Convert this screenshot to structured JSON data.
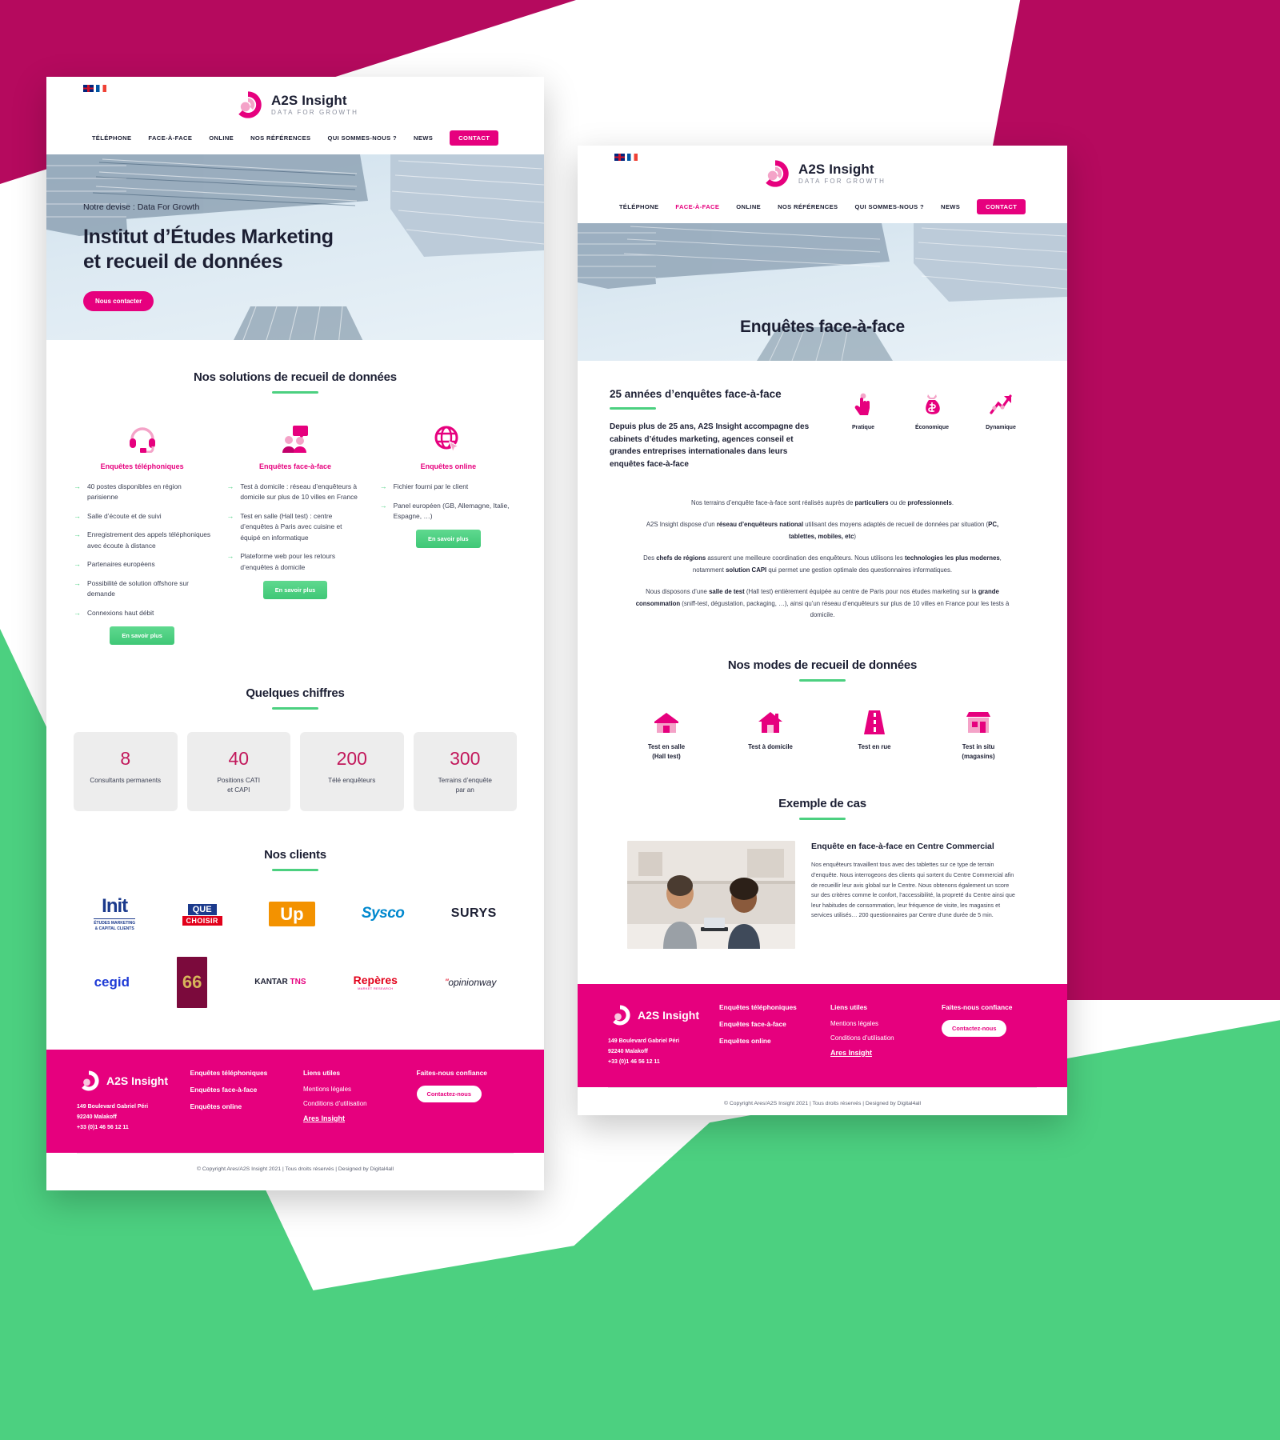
{
  "palette": {
    "magenta": "#b50a5e",
    "pink": "#e6007e",
    "green": "#4cd080",
    "ink": "#1c1f33",
    "grey_card": "#ededed",
    "stat_number": "#c2185b"
  },
  "brand": {
    "name": "A2S Insight",
    "tagline": "DATA FOR GROWTH",
    "logo_icon": "spiral-swirl-logo"
  },
  "languages": [
    {
      "name": "english-flag",
      "code": "EN"
    },
    {
      "name": "french-flag",
      "code": "FR"
    }
  ],
  "nav": {
    "items": [
      "TÉLÉPHONE",
      "FACE-À-FACE",
      "ONLINE",
      "NOS RÉFÉRENCES",
      "QUI SOMMES-NOUS ?",
      "NEWS"
    ],
    "cta": "CONTACT",
    "active_on_page2": "FACE-À-FACE"
  },
  "home": {
    "hero": {
      "kicker": "Notre devise : Data For Growth",
      "title": "Institut d’Études Marketing\net recueil de données",
      "button": "Nous contacter"
    },
    "solutions": {
      "title": "Nos solutions de recueil de données",
      "columns": [
        {
          "icon": "headset-icon",
          "heading": "Enquêtes téléphoniques",
          "bullets": [
            "40 postes disponibles en région parisienne",
            "Salle d’écoute et de suivi",
            "Enregistrement des appels téléphoniques avec écoute à distance",
            "Partenaires européens",
            "Possibilité de solution offshore sur demande",
            "Connexions haut débit"
          ],
          "button": "En savoir plus"
        },
        {
          "icon": "two-people-speech-icon",
          "heading": "Enquêtes face-à-face",
          "bullets": [
            "Test à domicile : réseau d’enquêteurs à domicile sur plus de 10 villes en France",
            "Test en salle (Hall test) : centre d’enquêtes à Paris avec cuisine et équipé en informatique",
            "Plateforme web pour les retours d’enquêtes à domicile"
          ],
          "button": "En savoir plus"
        },
        {
          "icon": "globe-cursor-icon",
          "heading": "Enquêtes online",
          "bullets": [
            "Fichier fourni par le client",
            "Panel européen (GB, Allemagne, Italie, Espagne, …)"
          ],
          "button": "En savoir plus"
        }
      ]
    },
    "figures": {
      "title": "Quelques chiffres",
      "stats": [
        {
          "number": "8",
          "label": "Consultants permanents"
        },
        {
          "number": "40",
          "label": "Positions CATI\net CAPI"
        },
        {
          "number": "200",
          "label": "Télé enquêteurs"
        },
        {
          "number": "300",
          "label": "Terrains d’enquête\npar an"
        }
      ]
    },
    "clients": {
      "title": "Nos clients",
      "row1": [
        {
          "name": "init",
          "label": "Init",
          "sub": "ÉTUDES MARKETING\n& CAPITAL CLIENTS",
          "color": "#1b3a8c"
        },
        {
          "name": "que-choisir",
          "label": "QUE CHOISIR",
          "color": "#e2001a"
        },
        {
          "name": "up",
          "label": "Up",
          "color": "#f39200"
        },
        {
          "name": "sysco",
          "label": "Sysco",
          "color": "#0088ce"
        },
        {
          "name": "surys",
          "label": "SURYS",
          "color": "#1c1f33"
        }
      ],
      "row2": [
        {
          "name": "cegid",
          "label": "cegid",
          "color": "#1f3bd6"
        },
        {
          "name": "route66",
          "label": "ROUTE 66",
          "color": "#7b0a3c"
        },
        {
          "name": "kantar-tns",
          "label": "KANTAR TNS",
          "color": "#1c1f33"
        },
        {
          "name": "reperes",
          "label": "Repères",
          "color": "#e2001a"
        },
        {
          "name": "opinionway",
          "label": "opinionway",
          "color": "#1c1f33"
        }
      ]
    }
  },
  "f2f": {
    "hero_title": "Enquêtes face-à-face",
    "intro": {
      "heading": "25 années d’enquêtes face-à-face",
      "paragraph": "Depuis plus de 25 ans, A2S Insight accompagne des cabinets d’études marketing, agences conseil et grandes entreprises internationales dans leurs enquêtes face-à-face"
    },
    "advantages": [
      {
        "icon": "hand-tap-icon",
        "label": "Pratique"
      },
      {
        "icon": "money-bag-icon",
        "label": "Économique"
      },
      {
        "icon": "arrow-chart-icon",
        "label": "Dynamique"
      }
    ],
    "paragraphs": [
      "Nos terrains d’enquête face-à-face sont réalisés auprès de <b>particuliers</b> ou de <b>professionnels</b>.",
      "A2S Insight dispose d’un <b>réseau d’enquêteurs national</b> utilisant des moyens adaptés de recueil de données par situation (<b>PC, tablettes, mobiles, etc</b>)",
      "Des <b>chefs de régions</b> assurent une meilleure coordination des enquêteurs. Nous utilisons les <b>technologies les plus modernes</b>, notamment <b>solution CAPI</b> qui permet une gestion optimale des questionnaires informatiques.",
      "Nous disposons d’une <b>salle de test</b> (Hall test) entièrement équipée au centre de Paris pour nos études marketing sur la <b>grande consommation</b> (sniff-test, dégustation, packaging, …), ainsi qu’un réseau d’enquêteurs sur plus de 10 villes en France pour les tests à domicile."
    ],
    "modes": {
      "title": "Nos modes de recueil de données",
      "items": [
        {
          "icon": "hall-test-icon",
          "label": "Test en salle\n(Hall test)"
        },
        {
          "icon": "house-icon",
          "label": "Test à domicile"
        },
        {
          "icon": "street-icon",
          "label": "Test en rue"
        },
        {
          "icon": "shop-icon",
          "label": "Test in situ\n(magasins)"
        }
      ]
    },
    "case": {
      "title": "Exemple de cas",
      "heading": "Enquête en face-à-face en Centre Commercial",
      "image": "interviewer-with-tablet-photo",
      "text": "Nos enquêteurs travaillent tous avec des tablettes sur ce type de terrain d’enquête. Nous interrogeons des clients qui sortent du Centre Commercial afin de recueillir leur avis global sur le Centre. Nous obtenons également un score sur des critères comme le confort, l’accessibilité, la propreté du Centre ainsi que leur habitudes de consommation, leur fréquence de visite, les magasins et services utilisés… 200 questionnaires par Centre d’une durée de 5 min."
    }
  },
  "footer": {
    "brand_name": "A2S Insight",
    "address_lines": [
      "149 Boulevard Gabriel Péri",
      "92240 Malakoff",
      "+33 (0)1 46 56 12 11"
    ],
    "services": [
      "Enquêtes téléphoniques",
      "Enquêtes face-à-face",
      "Enquêtes online"
    ],
    "useful_title": "Liens utiles",
    "useful": [
      "Mentions légales",
      "Conditions d’utilisation"
    ],
    "ares_link": "Ares Insight",
    "trust_title": "Faites-nous confiance",
    "trust_cta": "Contactez-nous",
    "copyright": "© Copyright Ares/A2S Insight 2021 | Tous droits réservés | Designed by Digital4all"
  }
}
